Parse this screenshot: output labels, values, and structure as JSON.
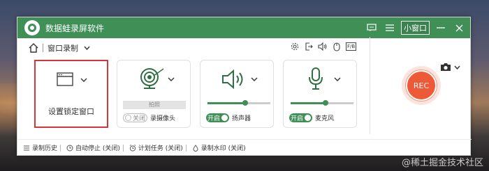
{
  "app": {
    "title": "数据蛙录屏软件",
    "mini_window_label": "小窗口"
  },
  "toolbar": {
    "mode_label": "窗口录制",
    "fb_label": "F/B"
  },
  "cards": {
    "window": {
      "label": "设置锁定窗口"
    },
    "webcam": {
      "label": "录摄像头",
      "toggle_label": "关闭",
      "photo_label": "拍照"
    },
    "speaker": {
      "label": "扬声器",
      "toggle_label": "开启",
      "volume": 0.6
    },
    "mic": {
      "label": "麦克风",
      "toggle_label": "开启",
      "volume": 0.55
    }
  },
  "rec": {
    "label": "REC"
  },
  "status": {
    "history": "录制历史",
    "auto_stop": "自动停止 (关闭)",
    "schedule": "计划任务 (关闭)",
    "watermark": "录制水印 (关闭)"
  },
  "watermark_text": "@稀土掘金技术社区",
  "colors": {
    "brand": "#3f8f57",
    "rec": "#ee5a38",
    "active_border": "#d6363a"
  },
  "icons": [
    "logo-icon",
    "feedback-icon",
    "menu-icon",
    "close-icon",
    "minimize-icon",
    "camera-icon",
    "home-icon",
    "settings-icon",
    "export-icon",
    "speaker-icon",
    "mouse-icon",
    "window-icon",
    "webcam-icon",
    "microphone-icon",
    "history-icon",
    "clock-icon",
    "schedule-icon",
    "watermark-icon"
  ]
}
